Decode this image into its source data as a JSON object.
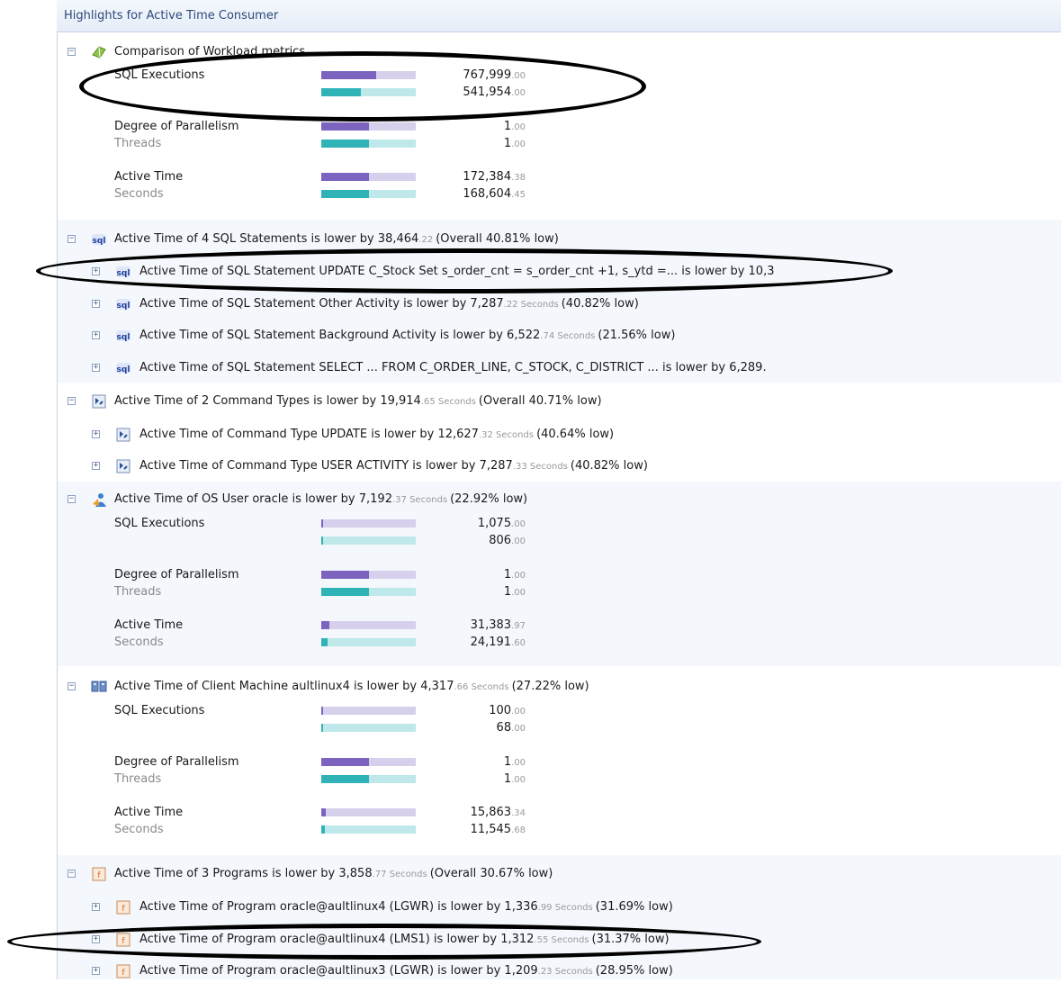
{
  "header": {
    "title": "Highlights for Active Time Consumer"
  },
  "unit_seconds": "Seconds",
  "sections": {
    "workload": {
      "title": "Comparison of Workload metrics",
      "metrics": [
        {
          "label": "SQL Executions",
          "unit": "",
          "v1_int": "767,999",
          "v1_dec": ".00",
          "v2_int": "541,954",
          "v2_dec": ".00",
          "f1": 0.58,
          "f2": 0.42
        },
        {
          "label": "Degree of Parallelism",
          "unit": "Threads",
          "v1_int": "1",
          "v1_dec": ".00",
          "v2_int": "1",
          "v2_dec": ".00",
          "f1": 0.5,
          "f2": 0.5
        },
        {
          "label": "Active Time",
          "unit": "Seconds",
          "v1_int": "172,384",
          "v1_dec": ".38",
          "v2_int": "168,604",
          "v2_dec": ".45",
          "f1": 0.5,
          "f2": 0.5
        }
      ]
    },
    "sql": {
      "title_pre": "Active Time of 4 SQL Statements is lower by 38,464",
      "title_dec": ".22",
      "title_post": "(Overall 40.81% low)",
      "items": [
        {
          "pre": "Active Time of SQL Statement UPDATE  C_Stock Set s_order_cnt = s_order_cnt +1, s_ytd =... is lower by 10,3",
          "dec": "",
          "post": ""
        },
        {
          "pre": "Active Time of SQL Statement Other  Activity is lower by 7,287",
          "dec": ".22 Seconds",
          "post": "(40.82% low)"
        },
        {
          "pre": "Active Time of SQL Statement Background  Activity is lower by 6,522",
          "dec": ".74 Seconds",
          "post": "(21.56% low)"
        },
        {
          "pre": "Active Time of SQL Statement SELECT ... FROM C_ORDER_LINE, C_STOCK, C_DISTRICT ... is lower by 6,289.",
          "dec": "",
          "post": ""
        }
      ]
    },
    "cmd": {
      "title_pre": "Active Time of 2 Command Types is lower by 19,914",
      "title_dec": ".65 Seconds",
      "title_post": "(Overall 40.71% low)",
      "items": [
        {
          "pre": "Active Time of Command Type UPDATE is lower by 12,627",
          "dec": ".32 Seconds",
          "post": "(40.64% low)"
        },
        {
          "pre": "Active Time of Command Type USER ACTIVITY is lower by 7,287",
          "dec": ".33 Seconds",
          "post": "(40.82% low)"
        }
      ]
    },
    "osuser": {
      "title_pre": "Active Time of OS User oracle is lower by 7,192",
      "title_dec": ".37 Seconds",
      "title_post": "(22.92% low)",
      "metrics": [
        {
          "label": "SQL Executions",
          "unit": "",
          "v1_int": "1,075",
          "v1_dec": ".00",
          "v2_int": "806",
          "v2_dec": ".00",
          "f1": 0.02,
          "f2": 0.015
        },
        {
          "label": "Degree of Parallelism",
          "unit": "Threads",
          "v1_int": "1",
          "v1_dec": ".00",
          "v2_int": "1",
          "v2_dec": ".00",
          "f1": 0.5,
          "f2": 0.5
        },
        {
          "label": "Active Time",
          "unit": "Seconds",
          "v1_int": "31,383",
          "v1_dec": ".97",
          "v2_int": "24,191",
          "v2_dec": ".60",
          "f1": 0.09,
          "f2": 0.07
        }
      ]
    },
    "client": {
      "title_pre": "Active Time of Client Machine aultlinux4 is lower by 4,317",
      "title_dec": ".66 Seconds",
      "title_post": "(27.22% low)",
      "metrics": [
        {
          "label": "SQL Executions",
          "unit": "",
          "v1_int": "100",
          "v1_dec": ".00",
          "v2_int": "68",
          "v2_dec": ".00",
          "f1": 0.015,
          "f2": 0.012
        },
        {
          "label": "Degree of Parallelism",
          "unit": "Threads",
          "v1_int": "1",
          "v1_dec": ".00",
          "v2_int": "1",
          "v2_dec": ".00",
          "f1": 0.5,
          "f2": 0.5
        },
        {
          "label": "Active Time",
          "unit": "Seconds",
          "v1_int": "15,863",
          "v1_dec": ".34",
          "v2_int": "11,545",
          "v2_dec": ".68",
          "f1": 0.05,
          "f2": 0.035
        }
      ]
    },
    "programs": {
      "title_pre": "Active Time of 3 Programs is lower by 3,858",
      "title_dec": ".77 Seconds",
      "title_post": "(Overall 30.67% low)",
      "items": [
        {
          "pre": "Active Time of Program oracle@aultlinux4 (LGWR) is lower by 1,336",
          "dec": ".99 Seconds",
          "post": "(31.69% low)"
        },
        {
          "pre": "Active Time of Program oracle@aultlinux4 (LMS1) is lower by 1,312",
          "dec": ".55 Seconds",
          "post": "(31.37% low)"
        },
        {
          "pre": "Active Time of Program oracle@aultlinux3 (LGWR) is lower by 1,209",
          "dec": ".23 Seconds",
          "post": "(28.95% low)"
        }
      ]
    }
  },
  "icons": {
    "workload": "workload-metrics-icon",
    "sql": "sql-icon",
    "cmd": "command-type-icon",
    "osuser": "os-user-icon",
    "client": "client-machine-icon",
    "programs": "program-icon",
    "expand": "expand-plus-icon",
    "collapse": "collapse-minus-icon"
  },
  "colors": {
    "bar_primary": "#7c63c0",
    "bar_primary_track": "#d7d0ec",
    "bar_secondary": "#2fb3b6",
    "bar_secondary_track": "#bfe8ea"
  }
}
